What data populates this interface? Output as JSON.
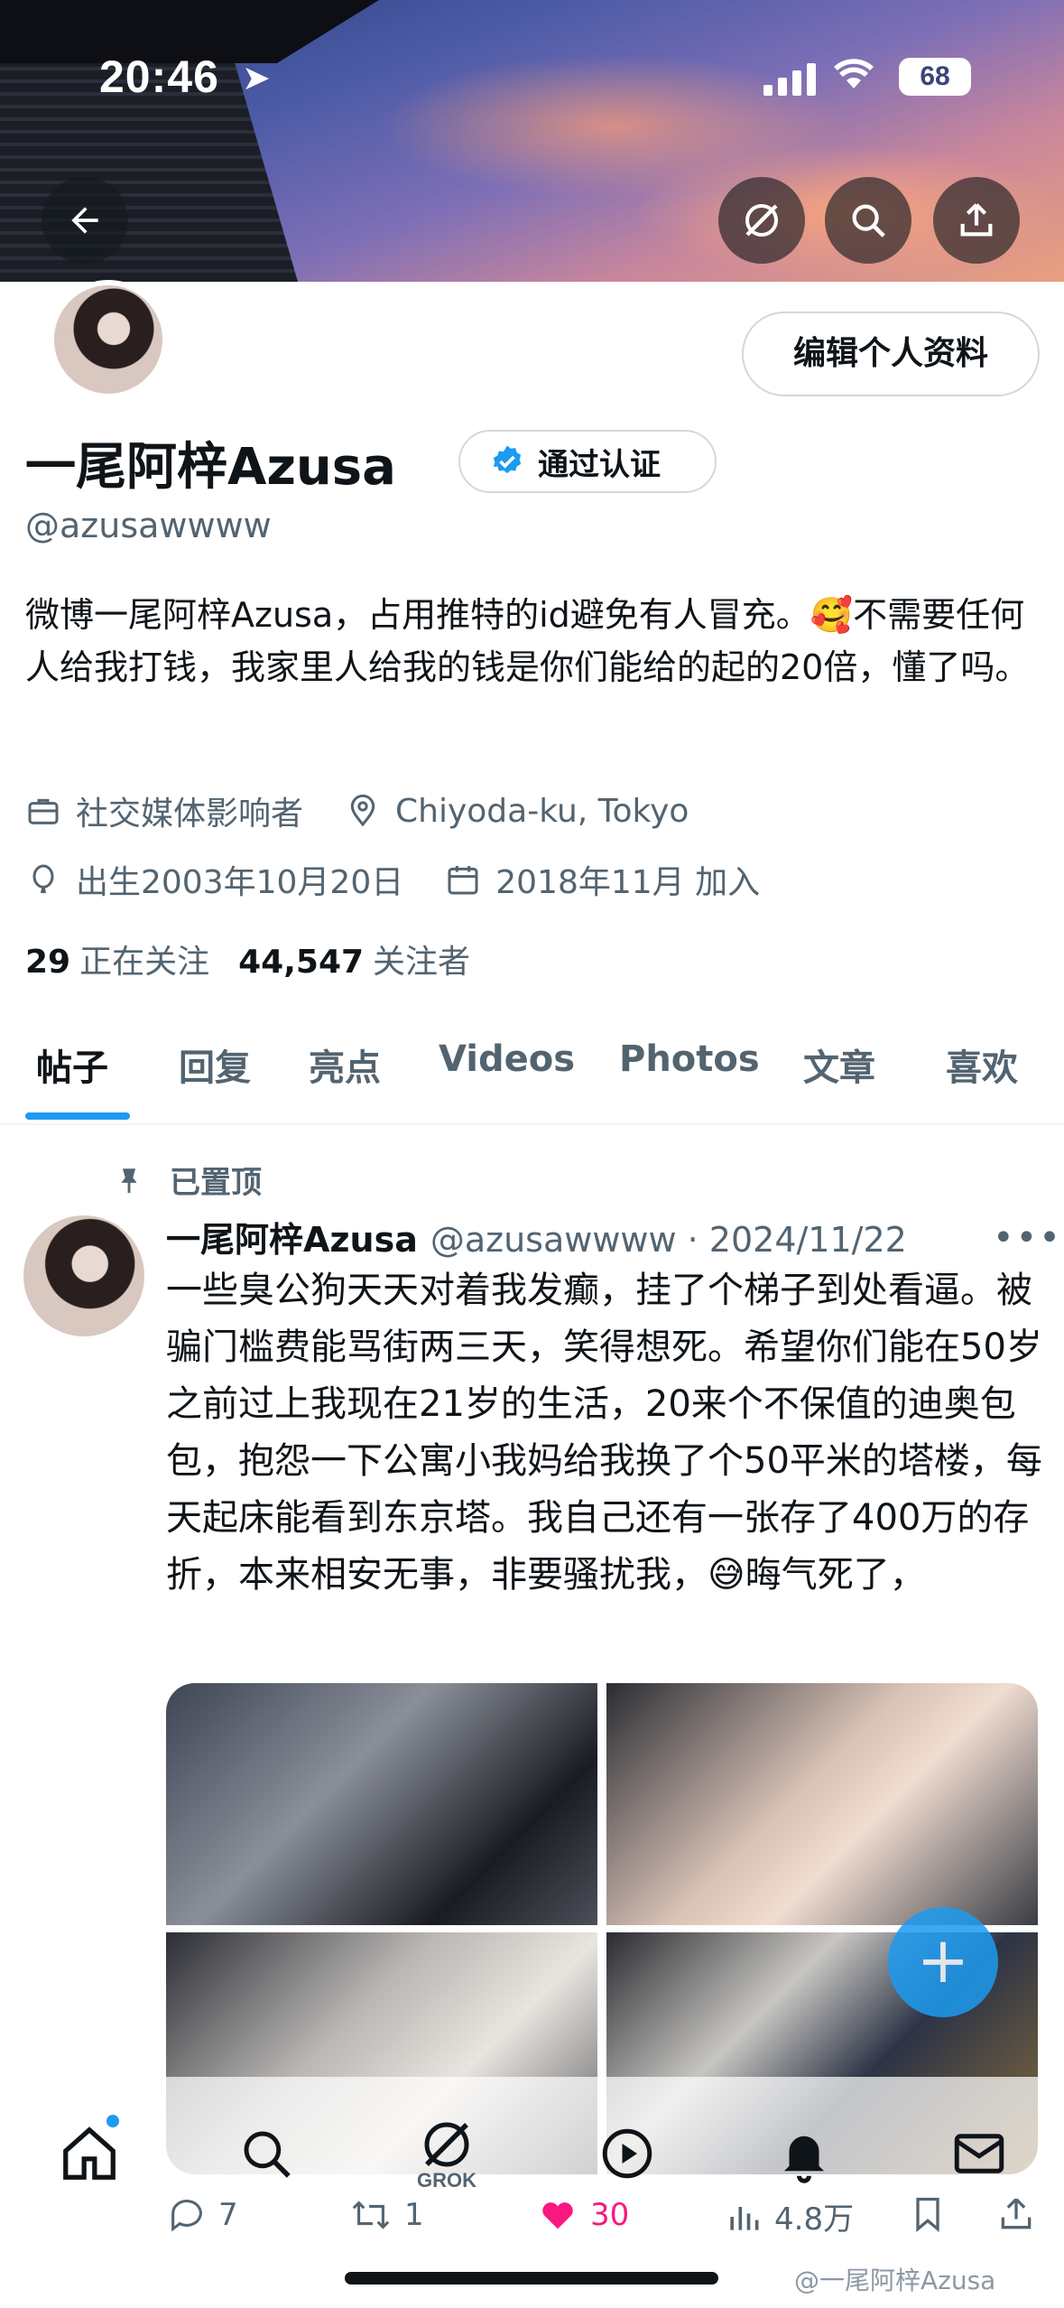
{
  "status_bar": {
    "time": "20:46",
    "battery": "68"
  },
  "profile": {
    "name": "一尾阿梓Azusa",
    "verified_label": "通过认证",
    "handle": "@azusawwww",
    "edit_button": "编辑个人资料",
    "bio": "微博一尾阿梓Azusa，占用推特的id避免有人冒充。🥰不需要任何人给我打钱，我家里人给我的钱是你们能给的起的20倍，懂了吗。",
    "category": "社交媒体影响者",
    "location": "Chiyoda-ku, Tokyo",
    "birthday": "出生2003年10月20日",
    "joined": "2018年11月 加入",
    "following_count": "29",
    "following_label": "正在关注",
    "followers_count": "44,547",
    "followers_label": "关注者"
  },
  "tabs": [
    "帖子",
    "回复",
    "亮点",
    "Videos",
    "Photos",
    "文章",
    "喜欢"
  ],
  "post": {
    "pinned_label": "已置顶",
    "author_name": "一尾阿梓Azusa",
    "author_meta": "@azusawwww · 2024/11/22",
    "text": "一些臭公狗天天对着我发癫，挂了个梯子到处看逼。被骗门槛费能骂街两三天，笑得想死。希望你们能在50岁之前过上我现在21岁的生活，20来个不保值的迪奥包包，抱怨一下公寓小我妈给我换了个50平米的塔楼，每天起床能看到东京塔。我自己还有一张存了400万的存折，本来相安无事，非要骚扰我，😅晦气死了，",
    "replies": "7",
    "reposts": "1",
    "likes": "30",
    "views": "4.8万"
  },
  "nav": {
    "grok_label": "GROK"
  },
  "watermark": "@一尾阿梓Azusa",
  "colors": {
    "accent": "#1d9bf0",
    "like": "#f91880",
    "text_secondary": "#536471"
  }
}
